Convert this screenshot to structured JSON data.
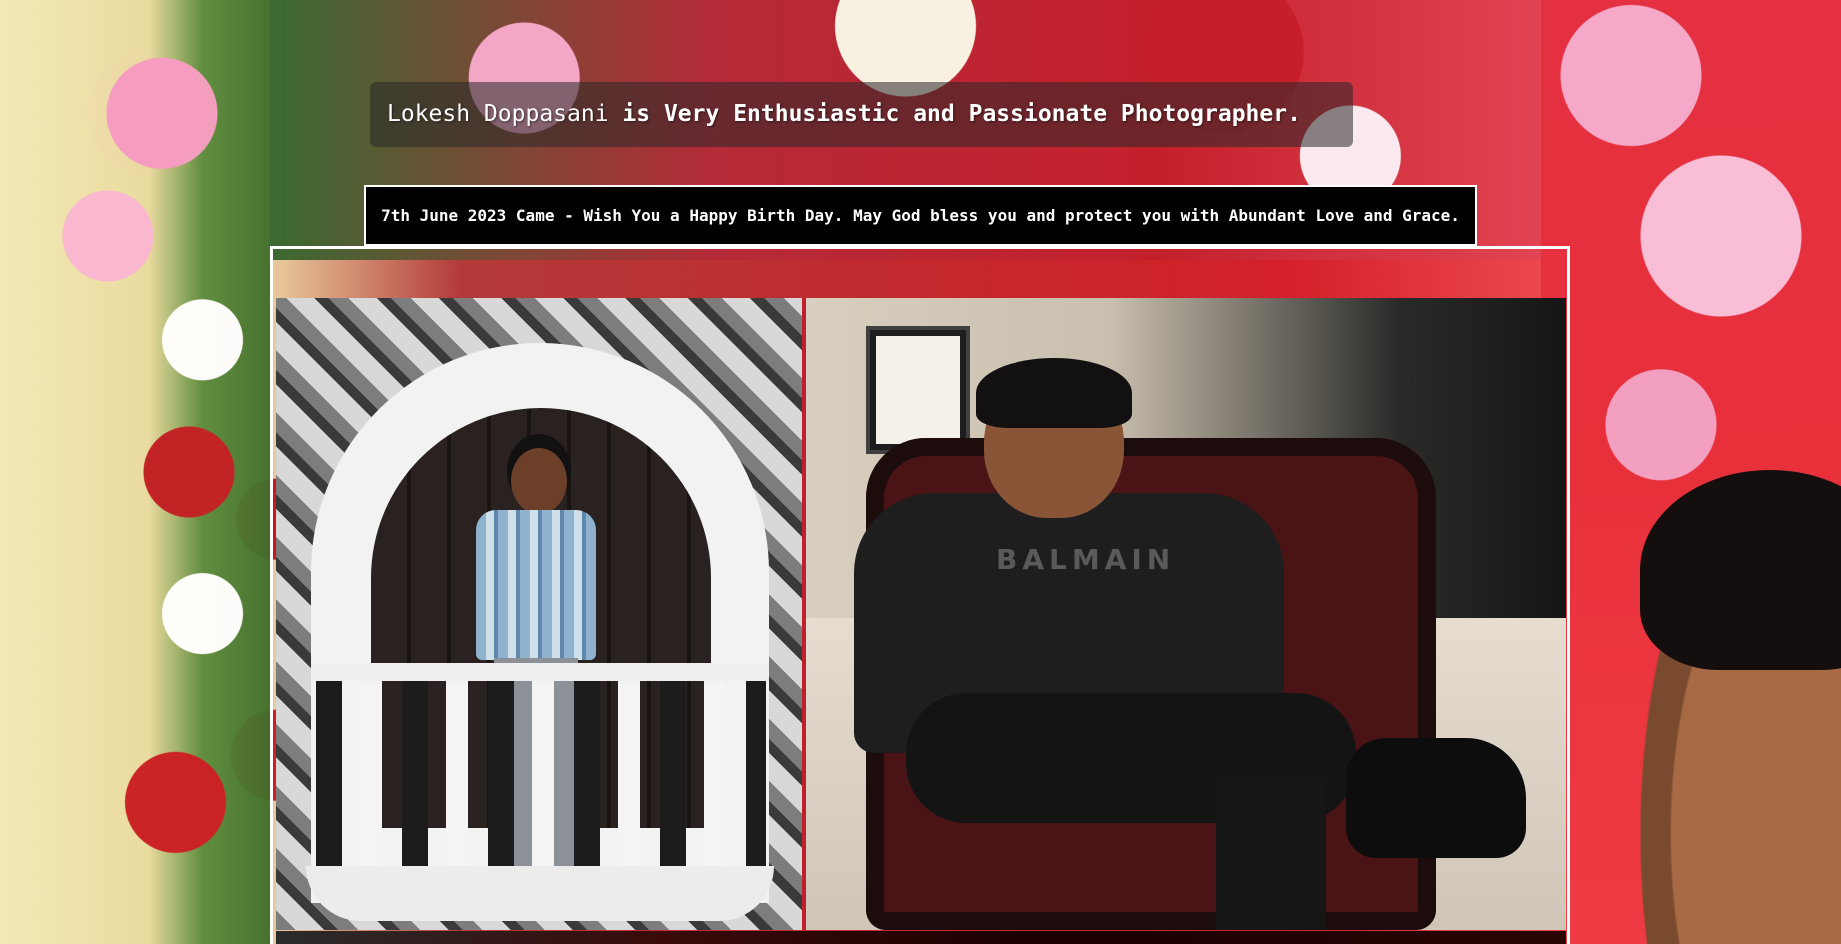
{
  "headline": {
    "name": "Lokesh Doppasani",
    "tagline": "is Very Enthusiastic and Passionate Photographer."
  },
  "banner": {
    "text": "7th June 2023 Came - Wish You a Happy Birth Day. May God bless you and protect you with Abundant Love and Grace."
  },
  "gallery": {
    "photos": [
      {
        "icon": "photo-balcony"
      },
      {
        "icon": "photo-chair"
      }
    ],
    "right_photo_shirt_text": "BALMAIN"
  },
  "colors": {
    "banner_bg": "#000000",
    "text": "#ffffff",
    "frame_border": "#ffffff",
    "frame_accent": "#c0202b"
  }
}
